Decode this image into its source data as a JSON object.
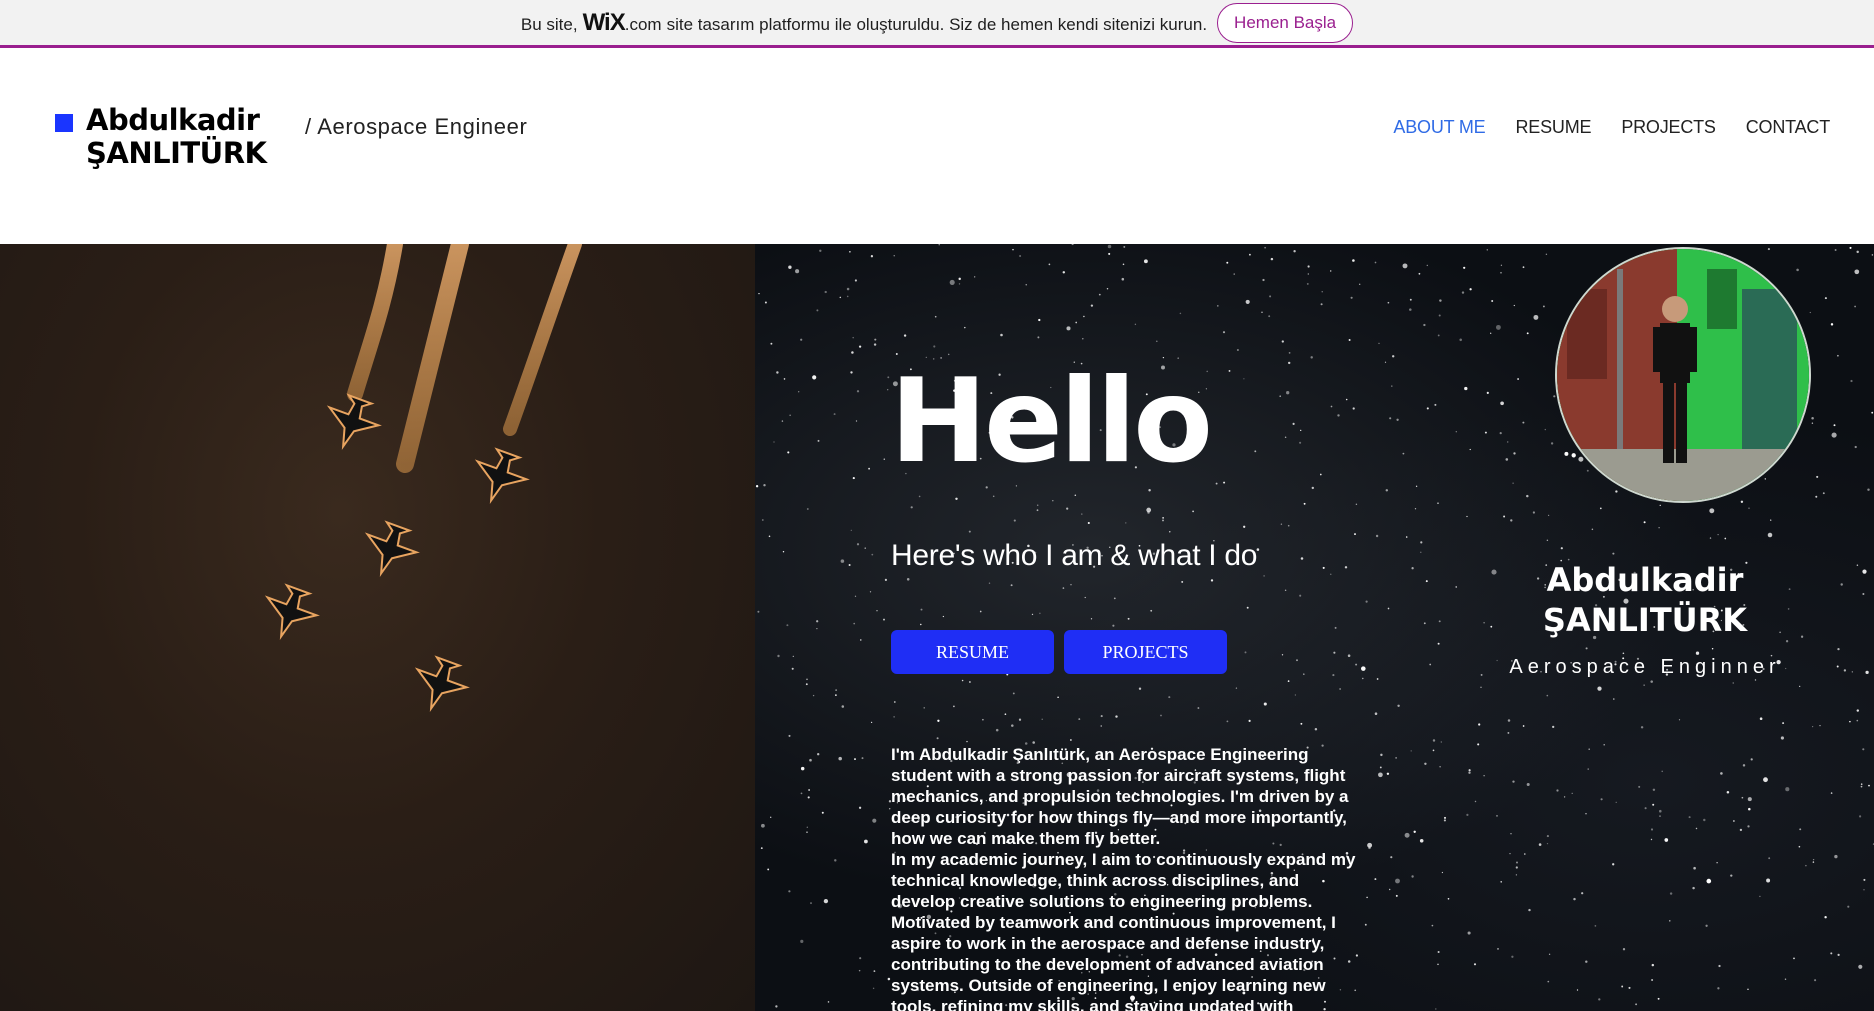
{
  "banner": {
    "text_before": "Bu site,",
    "wix_logo": "WiX",
    "wix_dotcom": ".com",
    "text_after": "site tasarım platformu ile oluşturuldu. Siz de hemen kendi sitenizi kurun.",
    "cta_label": "Hemen Başla",
    "accent_color": "#9a1f8f"
  },
  "header": {
    "logo_name_line1": "Abdulkadir",
    "logo_name_line2": "ŞANLITÜRK",
    "tagline": "/  Aerospace Engineer",
    "logo_color": "#1a35ff",
    "nav": [
      {
        "label": "ABOUT ME",
        "active": true
      },
      {
        "label": "RESUME",
        "active": false
      },
      {
        "label": "PROJECTS",
        "active": false
      },
      {
        "label": "CONTACT",
        "active": false
      }
    ],
    "nav_active_color": "#2f6be6"
  },
  "hero": {
    "title": "Hello",
    "subtitle": "Here's who I am & what I do",
    "buttons": [
      {
        "label": "RESUME"
      },
      {
        "label": "PROJECTS"
      }
    ],
    "button_color": "#1f2ef5",
    "bio_paragraphs": [
      "I'm Abdulkadir Şanlıtürk, an Aerospace Engineering student with a strong passion for aircraft systems, flight mechanics, and propulsion technologies. I'm driven by a deep curiosity for how things fly—and more importantly, how we can make them fly better.",
      "In my academic journey, I aim to continuously expand my technical knowledge, think across disciplines, and develop creative solutions to engineering problems. Motivated by teamwork and continuous improvement, I aspire to work in the aerospace and defense industry, contributing to the development of advanced aviation systems. Outside of engineering, I enjoy learning new tools, refining my skills, and staying updated with"
    ],
    "left_image_icon": "jets-formation-image"
  },
  "profile": {
    "photo_icon": "profile-photo",
    "name_line1": "Abdulkadir",
    "name_line2": "ŞANLITÜRK",
    "role": "Aerospace Enginner"
  }
}
